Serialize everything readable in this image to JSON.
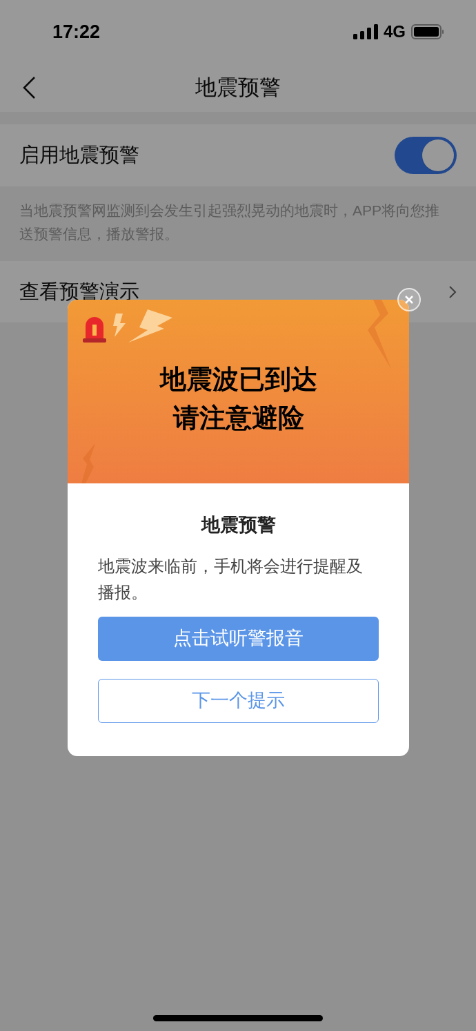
{
  "status_bar": {
    "time": "17:22",
    "network": "4G"
  },
  "nav": {
    "title": "地震预警"
  },
  "settings": {
    "toggle": {
      "label": "启用地震预警",
      "on": true
    },
    "description": "当地震预警网监测到会发生引起强烈晃动的地震时，APP将向您推送预警信息，播放警报。",
    "rows": [
      {
        "label": "查看预警演示"
      }
    ]
  },
  "dialog": {
    "banner_lines": [
      "地震波已到达",
      "请注意避险"
    ],
    "title": "地震预警",
    "body": "地震波来临前，手机将会进行提醒及播报。",
    "primary_button": "点击试听警报音",
    "secondary_button": "下一个提示"
  }
}
